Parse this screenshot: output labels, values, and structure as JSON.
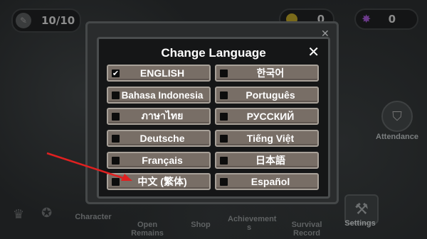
{
  "hud": {
    "energy": "10/10",
    "gold": "0",
    "gems": "0"
  },
  "side": {
    "attendance_label": "Attendance"
  },
  "bottom": {
    "items": [
      "Character",
      "Open Remains",
      "Shop",
      "Achievement s",
      "Survival Record",
      "Settings"
    ]
  },
  "dialog": {
    "title": "Change Language",
    "close_icon": "close-icon",
    "languages": [
      {
        "label": "ENGLISH",
        "checked": true
      },
      {
        "label": "한국어",
        "checked": false
      },
      {
        "label": "Bahasa Indonesia",
        "checked": false
      },
      {
        "label": "Português",
        "checked": false
      },
      {
        "label": "ภาษาไทย",
        "checked": false
      },
      {
        "label": "РУССКИЙ",
        "checked": false
      },
      {
        "label": "Deutsche",
        "checked": false
      },
      {
        "label": "Tiếng Việt",
        "checked": false
      },
      {
        "label": "Français",
        "checked": false
      },
      {
        "label": "日本語",
        "checked": false
      },
      {
        "label": "中文 (繁体)",
        "checked": false
      },
      {
        "label": "Español",
        "checked": false
      }
    ]
  },
  "colors": {
    "button_fill": "#786e66",
    "button_border": "#a8a199",
    "dialog_bg": "#151617",
    "arrow": "#e02020"
  }
}
